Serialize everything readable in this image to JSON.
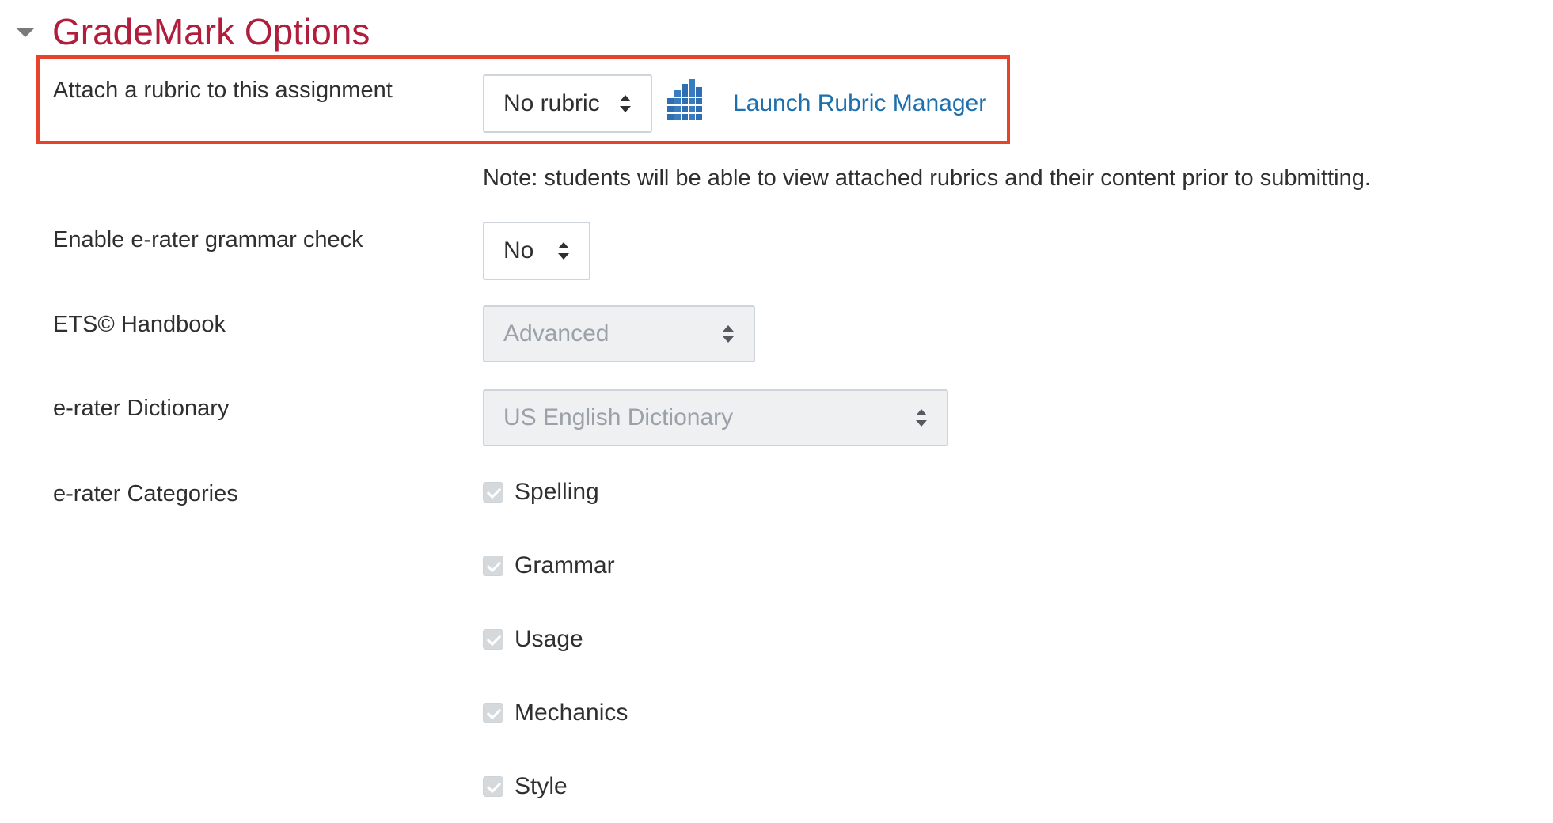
{
  "section": {
    "title": "GradeMark Options",
    "toggle_icon": "caret-down-icon"
  },
  "rubric": {
    "label": "Attach a rubric to this assignment",
    "selected": "No rubric",
    "icon": "rubric-manager-icon",
    "icon_color": "#2f6fb1",
    "launch_label": "Launch Rubric Manager",
    "note": "Note: students will be able to view attached rubrics and their content prior to submitting."
  },
  "erater": {
    "label": "Enable e-rater grammar check",
    "selected": "No"
  },
  "handbook": {
    "label": "ETS© Handbook",
    "selected": "Advanced",
    "disabled": true
  },
  "dictionary": {
    "label": "e-rater Dictionary",
    "selected": "US English Dictionary",
    "disabled": true
  },
  "categories": {
    "label": "e-rater Categories",
    "items": [
      {
        "label": "Spelling",
        "checked": true,
        "disabled": true
      },
      {
        "label": "Grammar",
        "checked": true,
        "disabled": true
      },
      {
        "label": "Usage",
        "checked": true,
        "disabled": true
      },
      {
        "label": "Mechanics",
        "checked": true,
        "disabled": true
      },
      {
        "label": "Style",
        "checked": true,
        "disabled": true
      }
    ]
  },
  "colors": {
    "title": "#b01e3c",
    "link": "#1d6fae",
    "highlight_border": "#e5432b",
    "disabled_bg": "#eef0f2"
  }
}
